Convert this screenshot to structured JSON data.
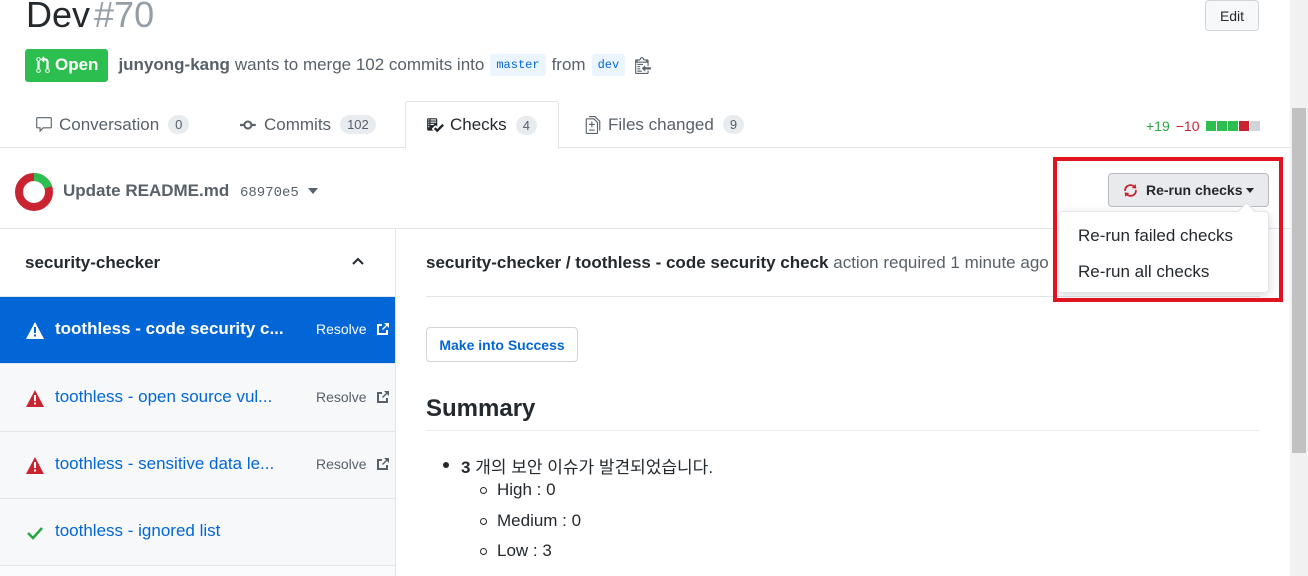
{
  "pr": {
    "title": "Dev",
    "number": "#70",
    "state": "Open",
    "author": "junyong-kang",
    "merge_text": "wants to merge 102 commits into",
    "base_branch": "master",
    "from_text": "from",
    "head_branch": "dev",
    "edit_label": "Edit"
  },
  "tabs": [
    {
      "label": "Conversation",
      "count": "0",
      "icon": "comment-icon"
    },
    {
      "label": "Commits",
      "count": "102",
      "icon": "commit-icon"
    },
    {
      "label": "Checks",
      "count": "4",
      "icon": "checklist-icon",
      "selected": true
    },
    {
      "label": "Files changed",
      "count": "9",
      "icon": "file-diff-icon"
    }
  ],
  "diffstat": {
    "additions": "+19",
    "deletions": "−10"
  },
  "commit": {
    "message": "Update README.md",
    "sha": "68970e5"
  },
  "rerun": {
    "button_label": "Re-run checks",
    "menu": [
      "Re-run failed checks",
      "Re-run all checks"
    ]
  },
  "sidebar": {
    "suite_name": "security-checker",
    "runs": [
      {
        "label": "toothless - code security c...",
        "status": "warning",
        "action": "Resolve",
        "active": true
      },
      {
        "label": "toothless - open source vul...",
        "status": "warning",
        "action": "Resolve"
      },
      {
        "label": "toothless - sensitive data le...",
        "status": "warning",
        "action": "Resolve"
      },
      {
        "label": "toothless - ignored list",
        "status": "success",
        "action": ""
      }
    ]
  },
  "main": {
    "check_title": "security-checker / toothless - code security check",
    "check_status": "action required 1 minute ago",
    "make_success_label": "Make into Success",
    "summary_heading": "Summary",
    "summary_count": "3",
    "summary_text": " 개의 보안 이슈가 발견되었습니다.",
    "severities": [
      "High : 0",
      "Medium : 0",
      "Low : 3"
    ]
  },
  "colors": {
    "open_green": "#2cbe4e",
    "link_blue": "#0366d6",
    "warning_red": "#cb2431",
    "success_green": "#28a745",
    "highlight_red": "#e0141f"
  }
}
